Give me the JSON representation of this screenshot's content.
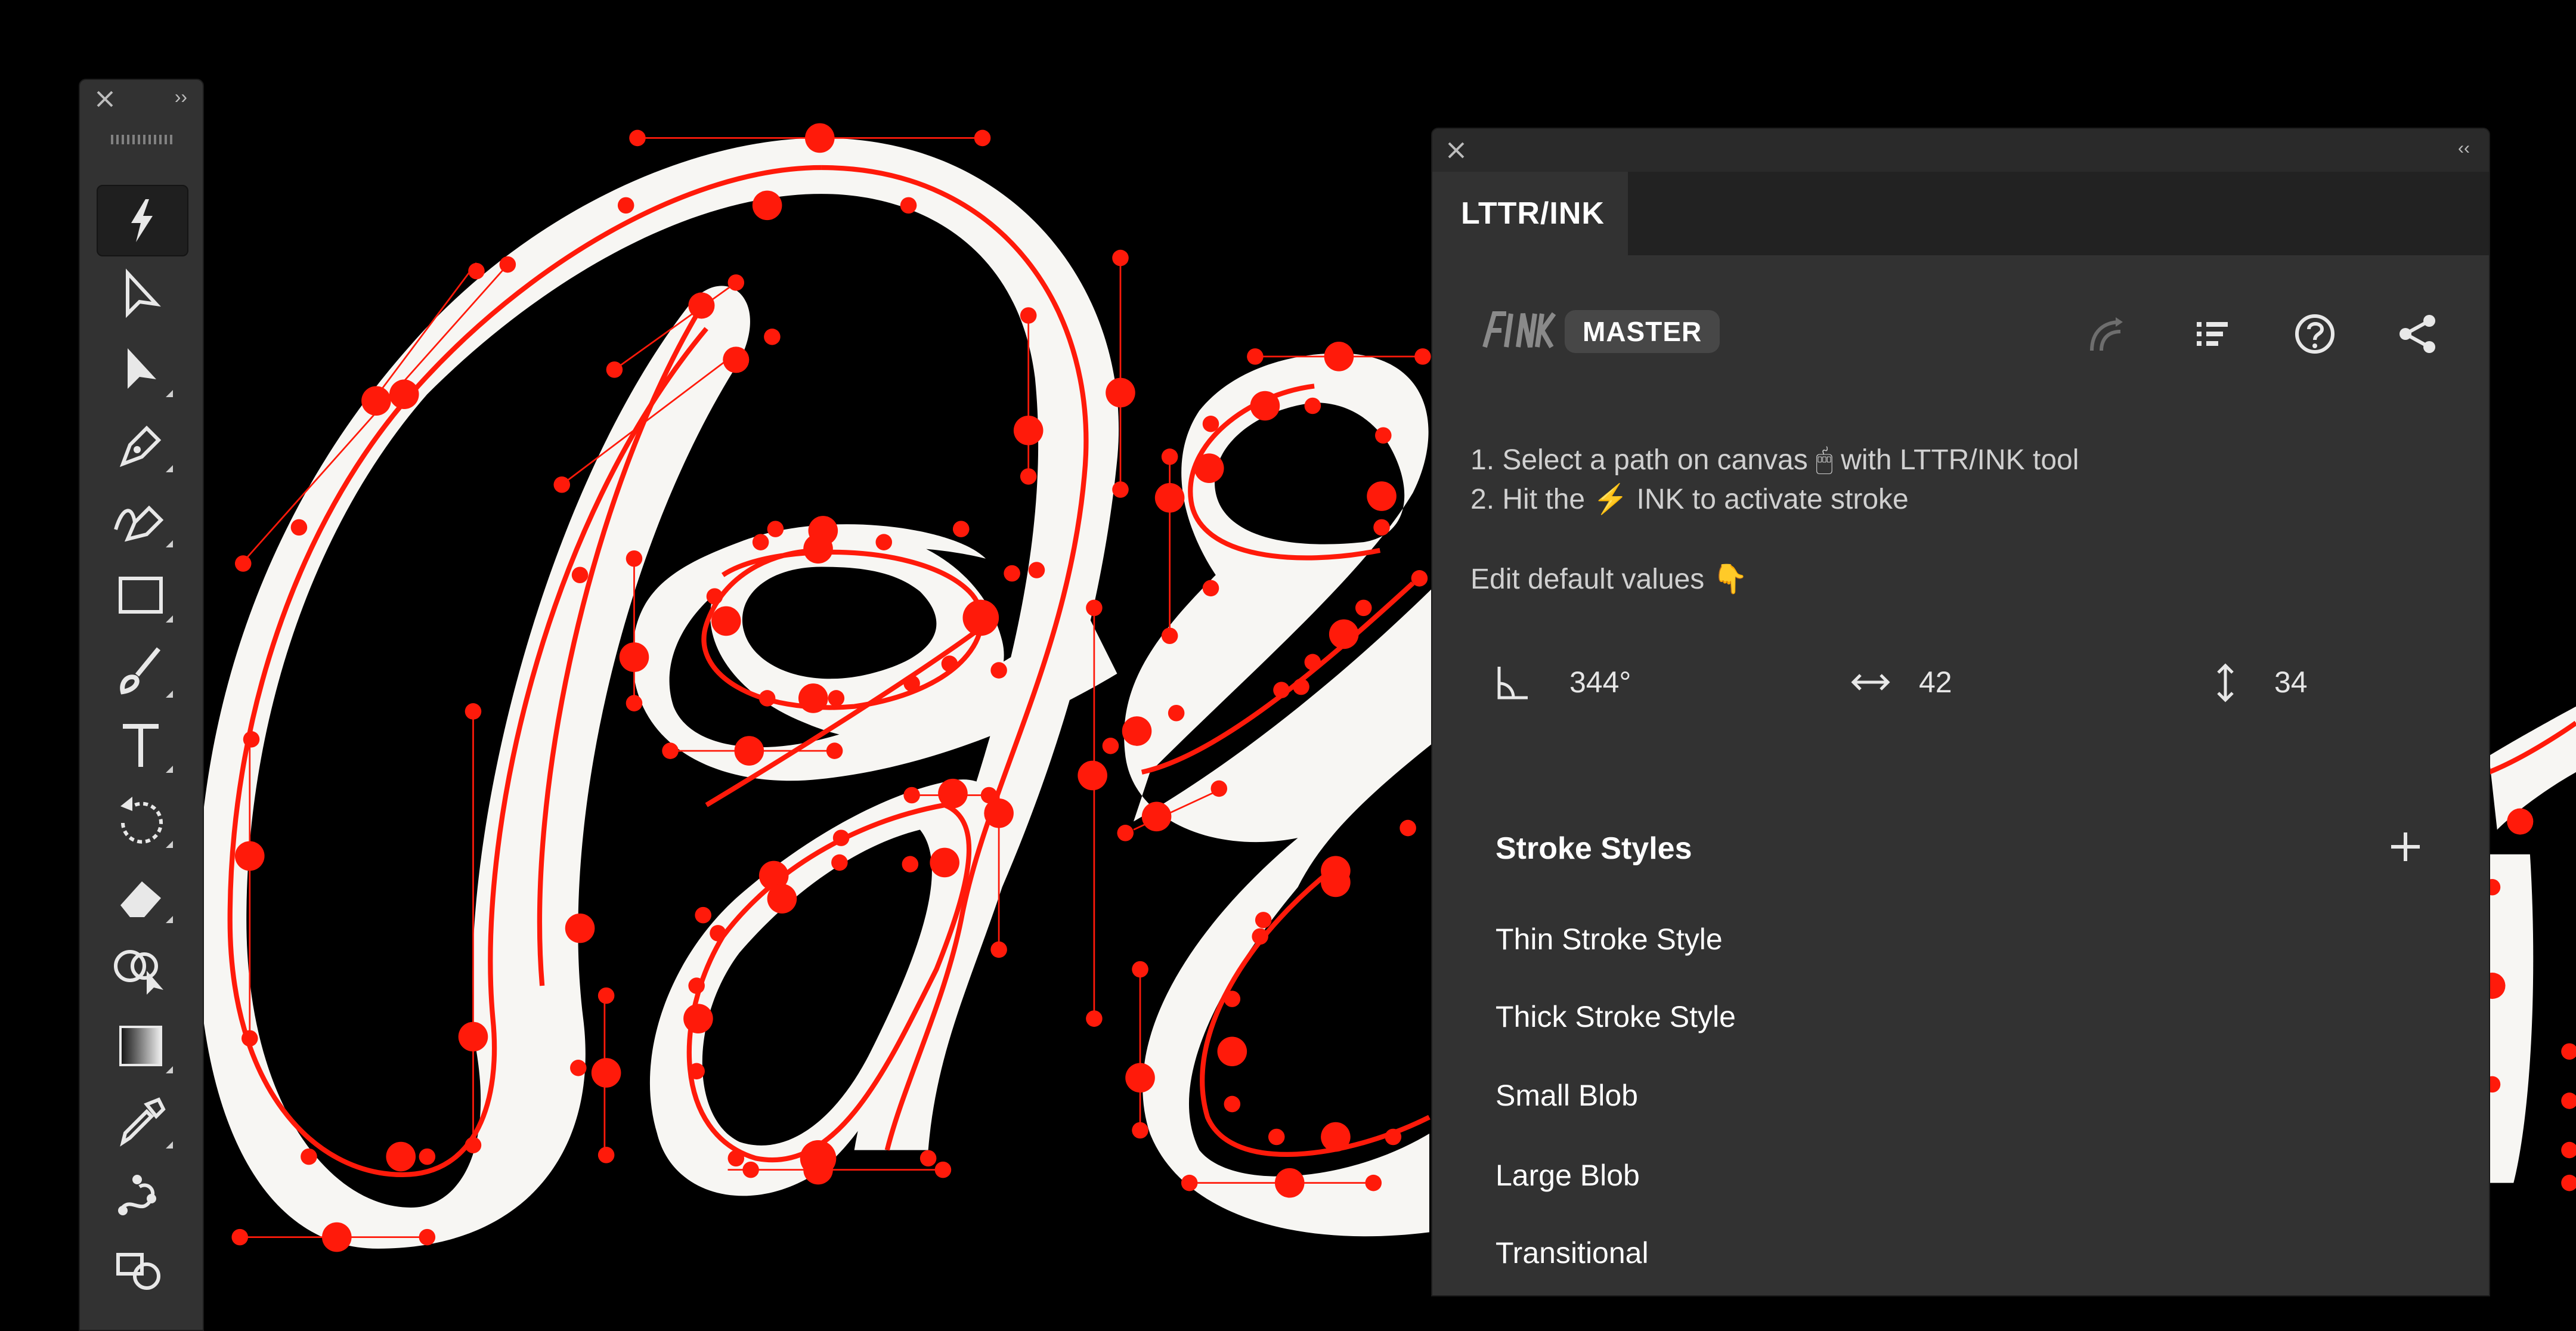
{
  "tools_panel": {
    "expand_glyph": "››",
    "tools": [
      "lttr-ink-tool",
      "direct-selection-tool",
      "selection-tool",
      "pen-tool",
      "curvature-pen-tool",
      "rectangle-tool",
      "paintbrush-tool",
      "type-tool",
      "rotate-tool",
      "eraser-tool",
      "shape-builder-tool",
      "gradient-tool",
      "eyedropper-tool",
      "puppet-warp-tool",
      "blend-tool"
    ]
  },
  "panel": {
    "collapse_glyph": "‹‹",
    "tab_label": "LTTR/INK",
    "brand_badge": "MASTER",
    "header_icons": [
      "stroke-direction-icon",
      "list-icon",
      "help-icon",
      "share-icon"
    ],
    "instructions": [
      "1. Select a path on canvas 🖱 with LTTR/INK tool",
      "2. Hit the ⚡ INK to activate stroke"
    ],
    "edit_defaults": "Edit default values 👇",
    "params": {
      "angle": "344°",
      "width": "42",
      "height": "34"
    },
    "stroke_styles_title": "Stroke Styles",
    "stroke_styles": [
      "Thin Stroke Style",
      "Thick Stroke Style",
      "Small Blob",
      "Large Blob",
      "Transitional"
    ]
  },
  "colors": {
    "canvas": "#000000",
    "stroke_fill": "#f7f6f3",
    "path_red": "#ff1a0a",
    "panel_bg": "#323232",
    "accent_bolt": "#f5c518"
  }
}
